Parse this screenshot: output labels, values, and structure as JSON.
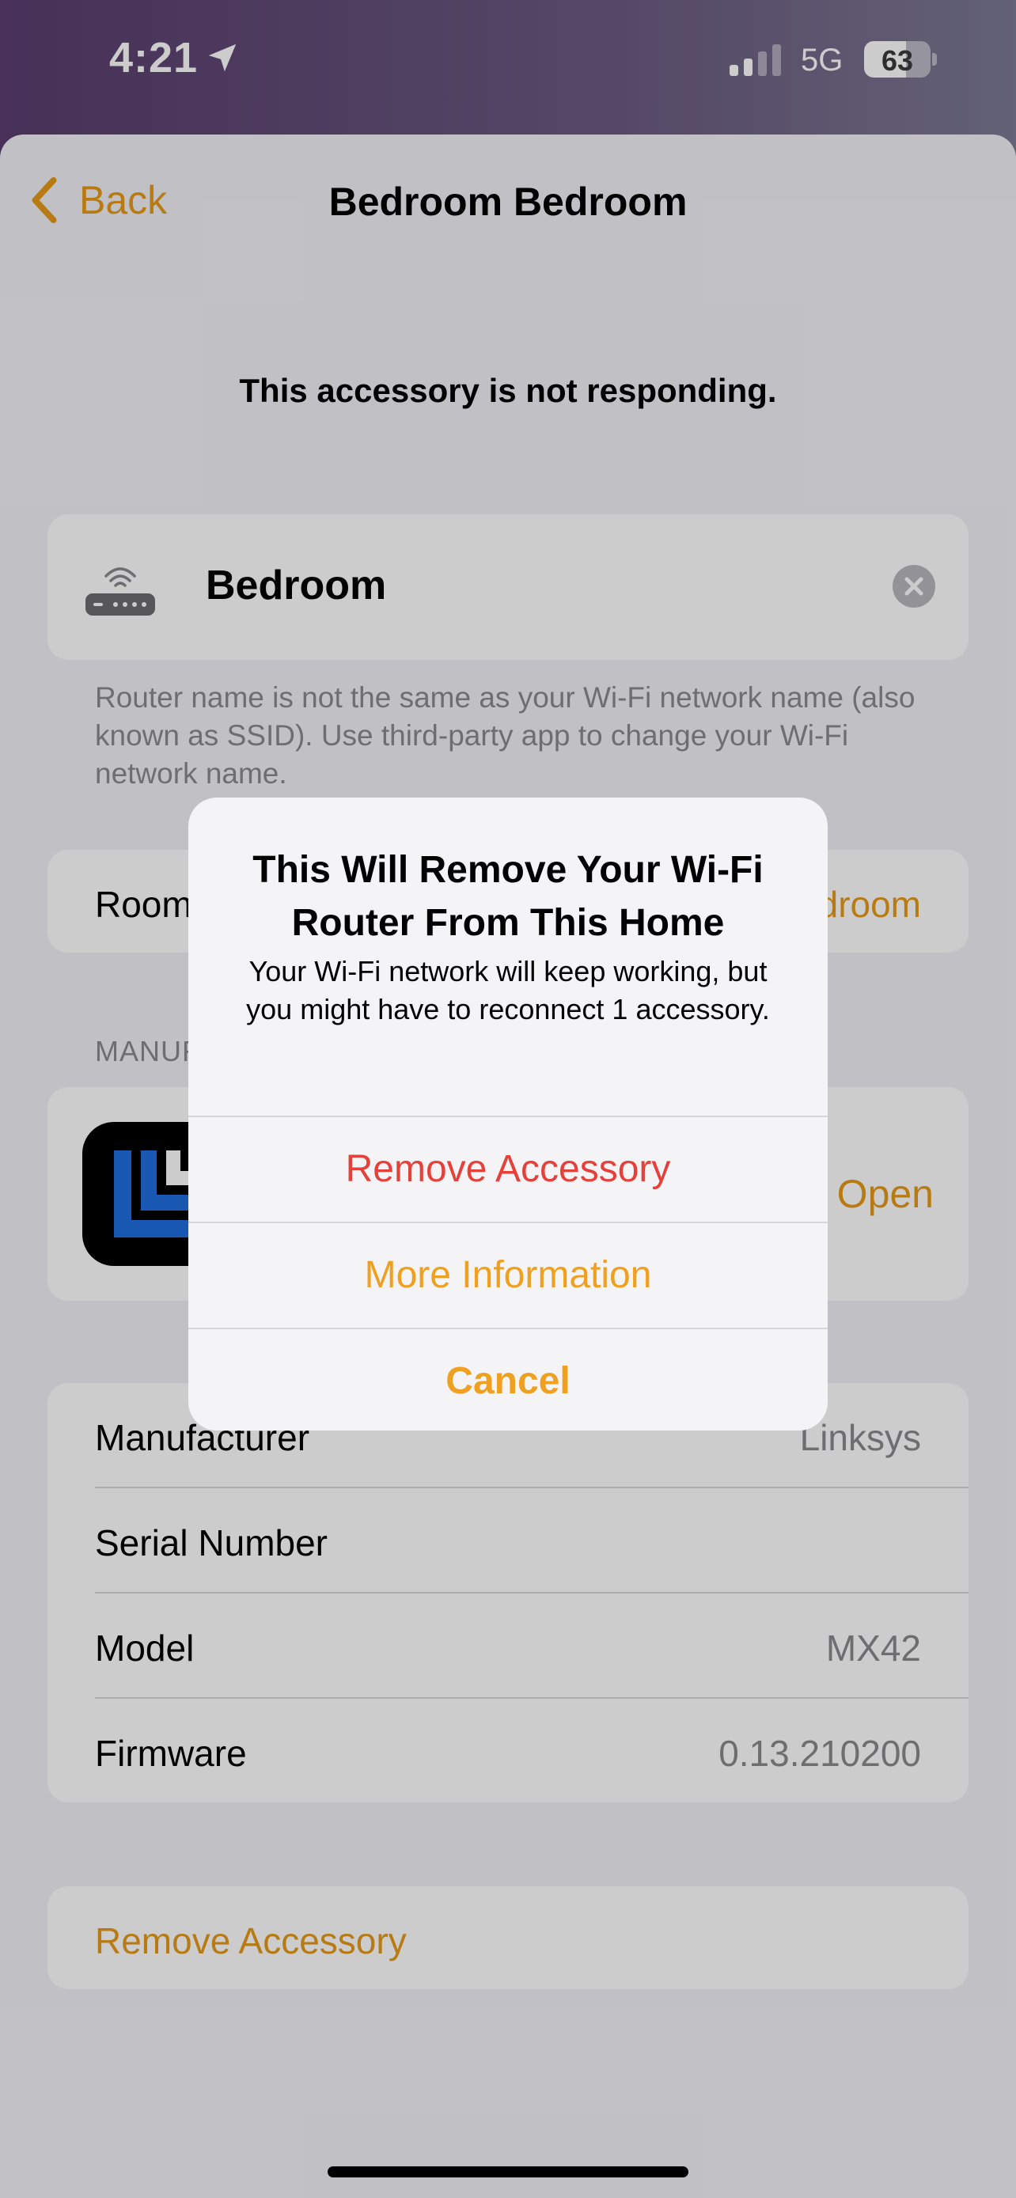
{
  "status_bar": {
    "time": "4:21",
    "network": "5G",
    "battery_level": "63",
    "battery_fraction": 0.63
  },
  "nav": {
    "back_label": "Back",
    "title": "Bedroom Bedroom"
  },
  "status_message": "This accessory is not responding.",
  "accessory": {
    "name": "Bedroom",
    "icon": "wifi-router-icon",
    "footnote": "Router name is not the same as your Wi-Fi network name (also known as SSID). Use third-party app to change your Wi-Fi network name."
  },
  "room": {
    "label": "Room",
    "value": "Bedroom"
  },
  "manufacturer_app": {
    "section_header": "MANUFACTURER APP",
    "open_label": "Open"
  },
  "info": [
    {
      "label": "Manufacturer",
      "value": "Linksys"
    },
    {
      "label": "Serial Number",
      "value": ""
    },
    {
      "label": "Model",
      "value": "MX42"
    },
    {
      "label": "Firmware",
      "value": "0.13.210200"
    }
  ],
  "remove_button_label": "Remove Accessory",
  "alert": {
    "title": "This Will Remove Your Wi-Fi Router From This Home",
    "message": "Your Wi-Fi network will keep working, but you might have to reconnect 1 accessory.",
    "buttons": {
      "remove": "Remove Accessory",
      "more_info": "More Information",
      "cancel": "Cancel"
    }
  },
  "colors": {
    "accent": "#e69a1a",
    "destructive": "#e5413a",
    "secondary_text": "#8a8a8e"
  }
}
